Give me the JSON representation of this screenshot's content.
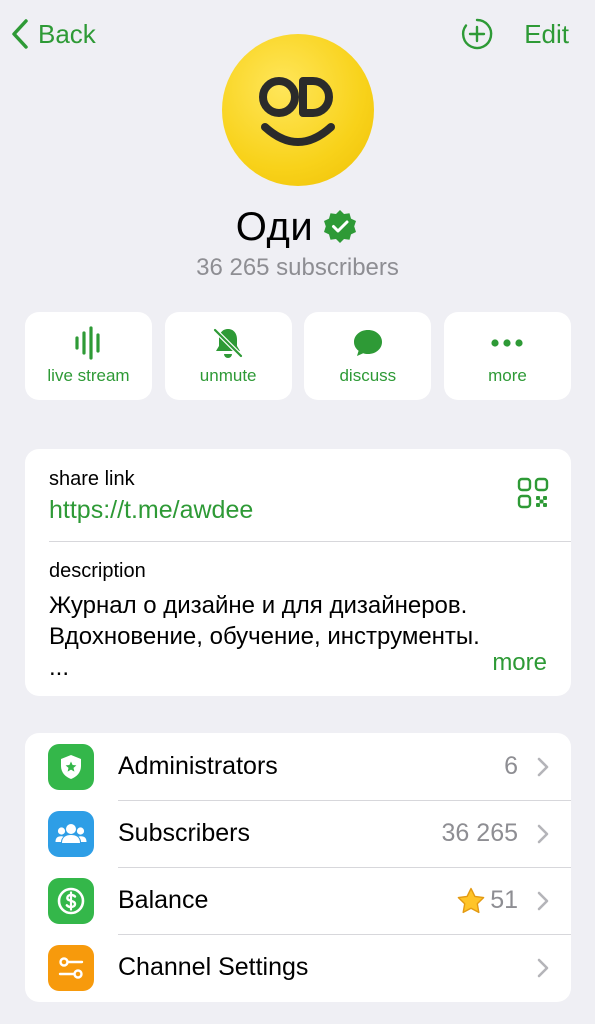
{
  "nav": {
    "back_label": "Back",
    "edit_label": "Edit"
  },
  "channel": {
    "name": "Оди",
    "subscribers_text": "36 265 subscribers",
    "verified": true
  },
  "actions": [
    {
      "label": "live stream",
      "icon": "live-stream-icon"
    },
    {
      "label": "unmute",
      "icon": "bell-slash-icon"
    },
    {
      "label": "discuss",
      "icon": "chat-bubble-icon"
    },
    {
      "label": "more",
      "icon": "ellipsis-icon"
    }
  ],
  "info": {
    "share_label": "share link",
    "share_link": "https://t.me/awdee",
    "description_label": "description",
    "description_lines": [
      "Журнал о дизайне и для дизайнеров.",
      "Вдохновение, обучение, инструменты.",
      "..."
    ],
    "more_label": "more"
  },
  "menu": [
    {
      "label": "Administrators",
      "value": "6",
      "icon": "shield-star-icon",
      "color": "#34b74a"
    },
    {
      "label": "Subscribers",
      "value": "36 265",
      "icon": "people-icon",
      "color": "#2e9ee6"
    },
    {
      "label": "Balance",
      "value": "51",
      "icon": "dollar-icon",
      "color": "#34b74a",
      "badge_icon": "star-icon"
    },
    {
      "label": "Channel Settings",
      "value": "",
      "icon": "sliders-icon",
      "color": "#f79a0c"
    }
  ],
  "colors": {
    "accent": "#2e9a36",
    "background": "#efeff4"
  }
}
